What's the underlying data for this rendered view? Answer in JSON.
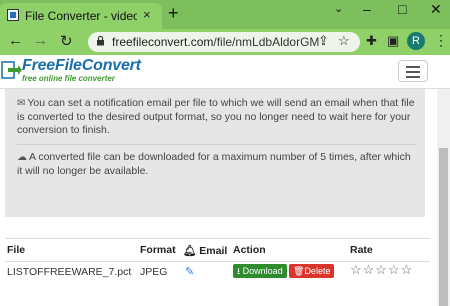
{
  "browser": {
    "tab": {
      "title": "File Converter - video converter",
      "close_icon": "×"
    },
    "new_tab_icon": "+",
    "window_controls": {
      "chevron": "⌄",
      "minimize": "–",
      "maximize": "□",
      "close": "✕"
    },
    "nav": {
      "back": "←",
      "forward": "→",
      "reload": "↻"
    },
    "url": {
      "domain": "freefileconvert.com",
      "path": "/file/nmLdbAldorGM"
    },
    "toolbar_icons": {
      "share": "⇪",
      "bookmark": "☆",
      "extensions": "✚",
      "sidebar": "▣"
    },
    "profile_initial": "R",
    "menu_icon": "⋮"
  },
  "site": {
    "logo": {
      "name": "FreeFileConvert",
      "tagline": "free online file converter"
    }
  },
  "info": {
    "notification_text": "You can set a notification email per file to which we will send an email when that file is converted to the desired output format, so you no longer need to wait here for your conversion to finish.",
    "download_limit_text": "A converted file can be downloaded for a maximum number of 5 times, after which it will no longer be available."
  },
  "table": {
    "headers": {
      "file": "File",
      "format": "Format",
      "email": "Email",
      "action": "Action",
      "rate": "Rate"
    },
    "rows": [
      {
        "file": "LISTOFFREEWARE_7.pct",
        "format": "JPEG",
        "download": "Download",
        "delete": "Delete",
        "stars": "☆☆☆☆☆"
      }
    ]
  },
  "colors": {
    "browser_green": "#8fd068",
    "download_green": "#2e8b2e",
    "delete_red": "#d9352b",
    "link_blue": "#2a7ae2"
  }
}
